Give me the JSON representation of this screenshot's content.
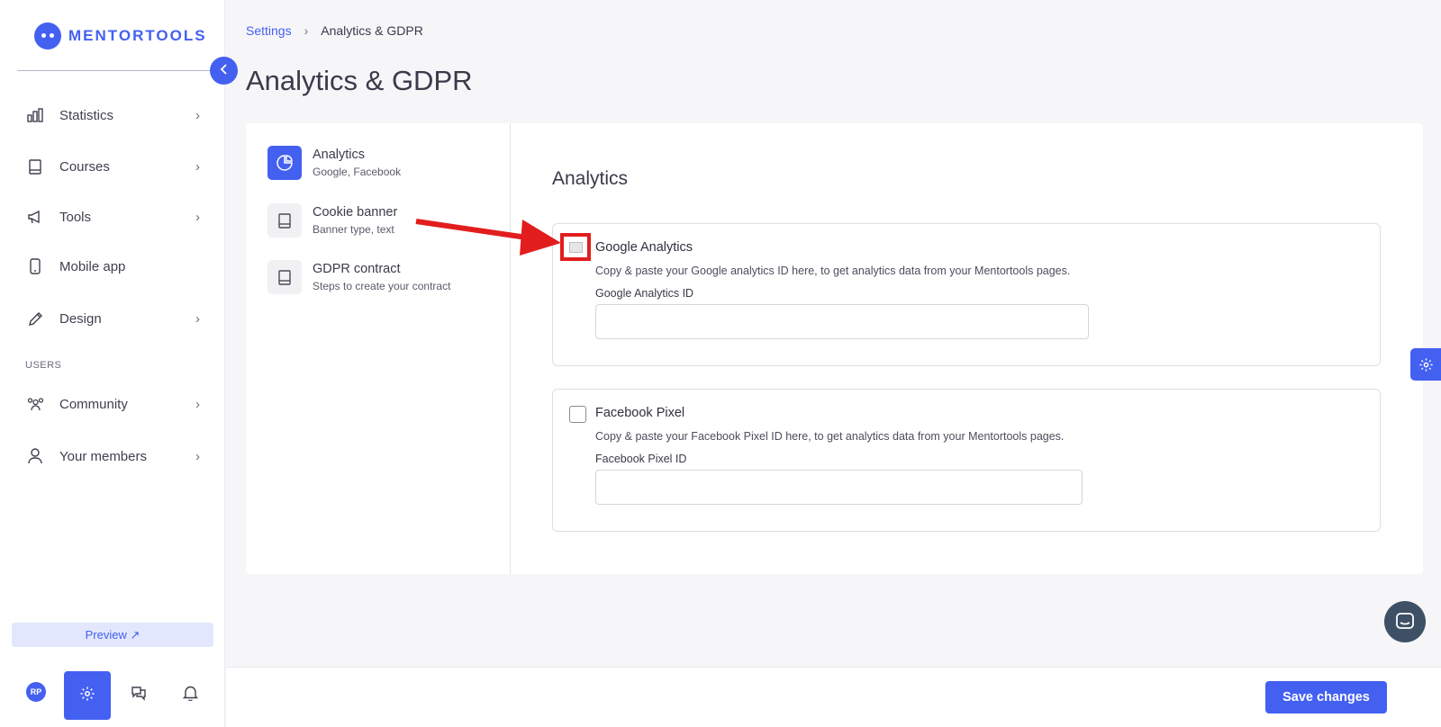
{
  "brand": {
    "name": "MENTORTOOLS"
  },
  "sidebar": {
    "items": [
      {
        "label": "Statistics",
        "icon": "bar-chart-icon",
        "has_chevron": true
      },
      {
        "label": "Courses",
        "icon": "book-icon",
        "has_chevron": true
      },
      {
        "label": "Tools",
        "icon": "megaphone-icon",
        "has_chevron": true
      },
      {
        "label": "Mobile app",
        "icon": "mobile-icon",
        "has_chevron": false
      },
      {
        "label": "Design",
        "icon": "pencil-icon",
        "has_chevron": true
      }
    ],
    "section_label": "USERS",
    "user_items": [
      {
        "label": "Community",
        "icon": "people-icon",
        "has_chevron": true
      },
      {
        "label": "Your members",
        "icon": "user-icon",
        "has_chevron": true
      }
    ],
    "preview_label": "Preview ↗",
    "avatar_initials": "RP"
  },
  "breadcrumb": {
    "parent": "Settings",
    "current": "Analytics & GDPR"
  },
  "page": {
    "title": "Analytics & GDPR"
  },
  "subnav": [
    {
      "title": "Analytics",
      "desc": "Google, Facebook",
      "active": true
    },
    {
      "title": "Cookie banner",
      "desc": "Banner type, text",
      "active": false
    },
    {
      "title": "GDPR contract",
      "desc": "Steps to create your contract",
      "active": false
    }
  ],
  "content": {
    "section_title": "Analytics",
    "google": {
      "title": "Google Analytics",
      "desc": "Copy & paste your Google analytics ID here, to get analytics data from your Mentortools pages.",
      "label": "Google Analytics ID",
      "value": "",
      "checked": false
    },
    "facebook": {
      "title": "Facebook Pixel",
      "desc": "Copy & paste your Facebook Pixel ID here, to get analytics data from your Mentortools pages.",
      "label": "Facebook Pixel ID",
      "value": "",
      "checked": false
    }
  },
  "footer": {
    "save_label": "Save changes"
  },
  "colors": {
    "accent": "#4460f1",
    "annotation": "#e21d1d",
    "chat": "#3e5065"
  }
}
